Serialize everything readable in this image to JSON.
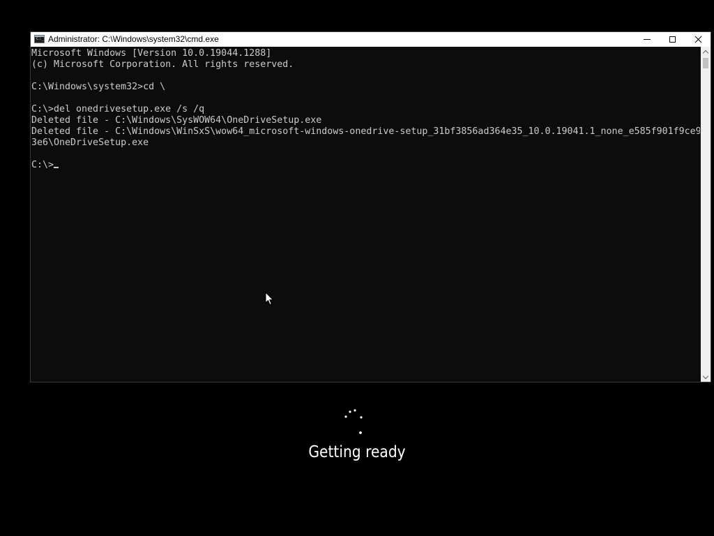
{
  "window": {
    "title": "Administrator: C:\\Windows\\system32\\cmd.exe",
    "icon": "console-icon",
    "controls": {
      "minimize": "minimize-icon",
      "maximize": "maximize-icon",
      "close": "close-icon"
    }
  },
  "console": {
    "lines": [
      "Microsoft Windows [Version 10.0.19044.1288]",
      "(c) Microsoft Corporation. All rights reserved.",
      "",
      "C:\\Windows\\system32>cd \\",
      "",
      "C:\\>del onedrivesetup.exe /s /q",
      "Deleted file - C:\\Windows\\SysWOW64\\OneDriveSetup.exe",
      "Deleted file - C:\\Windows\\WinSxS\\wow64_microsoft-windows-onedrive-setup_31bf3856ad364e35_10.0.19041.1_none_e585f901f9ce9",
      "3e6\\OneDriveSetup.exe",
      ""
    ],
    "prompt": "C:\\>"
  },
  "setup": {
    "status": "Getting ready"
  },
  "colors": {
    "desktop_background": "#000000",
    "console_background": "#0c0c0c",
    "console_text": "#cccccc",
    "titlebar": "#ffffff",
    "status_text": "#ffffff"
  }
}
